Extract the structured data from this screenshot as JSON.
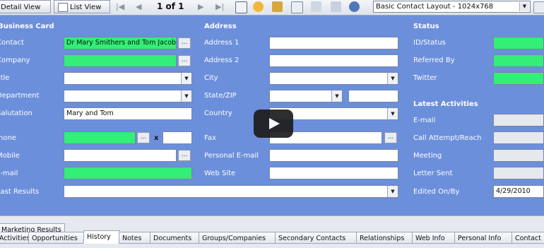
{
  "toolbar": {
    "detail_view": "Detail View",
    "list_view": "List View",
    "pager": "1 of 1",
    "layout": "Basic Contact Layout - 1024x768"
  },
  "sections": {
    "business_card": "Business Card",
    "address": "Address",
    "status": "Status",
    "latest_activities": "Latest Activities"
  },
  "labels": {
    "contact": "Contact",
    "company": "Company",
    "title": "Title",
    "department": "Department",
    "salutation": "Salutation",
    "phone": "Phone",
    "mobile": "Mobile",
    "email": "E-mail",
    "last_results": "Last Results",
    "address1": "Address 1",
    "address2": "Address 2",
    "city": "City",
    "state_zip": "State/ZIP",
    "country": "Country",
    "fax": "Fax",
    "personal_email": "Personal E-mail",
    "web_site": "Web Site",
    "id_status": "ID/Status",
    "referred_by": "Referred By",
    "twitter": "Twitter",
    "email_activity": "E-mail",
    "call_attempt": "Call Attempt/Reach",
    "meeting": "Meeting",
    "letter_sent": "Letter Sent",
    "edited_on_by": "Edited On/By"
  },
  "values": {
    "contact": "Dr Mary Smithers and Tom Jacobs",
    "salutation": "Mary and Tom",
    "phone_ext_sep": "x",
    "edited_on": "4/29/2010"
  },
  "tabs": {
    "marketing_results": "Marketing Results",
    "items": [
      "Activities",
      "Opportunities",
      "History",
      "Notes",
      "Documents",
      "Groups/Companies",
      "Secondary Contacts",
      "Relationships",
      "Web Info",
      "Personal Info",
      "Contact"
    ],
    "active": "History"
  },
  "colors": {
    "form_bg": "#6b8fdb",
    "required_field": "#33ee77"
  }
}
